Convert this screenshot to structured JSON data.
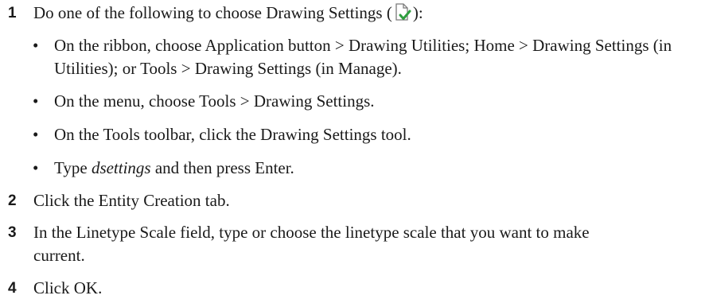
{
  "steps": [
    {
      "num": "1",
      "text_before": "Do one of the following to choose Drawing Settings (",
      "icon": "drawing-settings-icon",
      "text_after": "):",
      "bullets": [
        "On the ribbon, choose Application button > Drawing Utilities; Home > Drawing Settings (in Utilities); or Tools > Drawing Settings (in Manage).",
        "On the menu, choose Tools > Drawing Settings.",
        "On the Tools toolbar, click the Drawing Settings tool."
      ],
      "last_bullet": {
        "prefix": "Type ",
        "command": "dsettings",
        "suffix": " and then press Enter."
      }
    },
    {
      "num": "2",
      "text": "Click the Entity Creation tab."
    },
    {
      "num": "3",
      "text": "In the Linetype Scale field, type or choose the linetype scale that you want to make current."
    },
    {
      "num": "4",
      "text": "Click OK."
    }
  ],
  "colors": {
    "text": "#1a1a1a",
    "icon_check": "#2e9e3e",
    "icon_outline": "#7a7a7a"
  }
}
